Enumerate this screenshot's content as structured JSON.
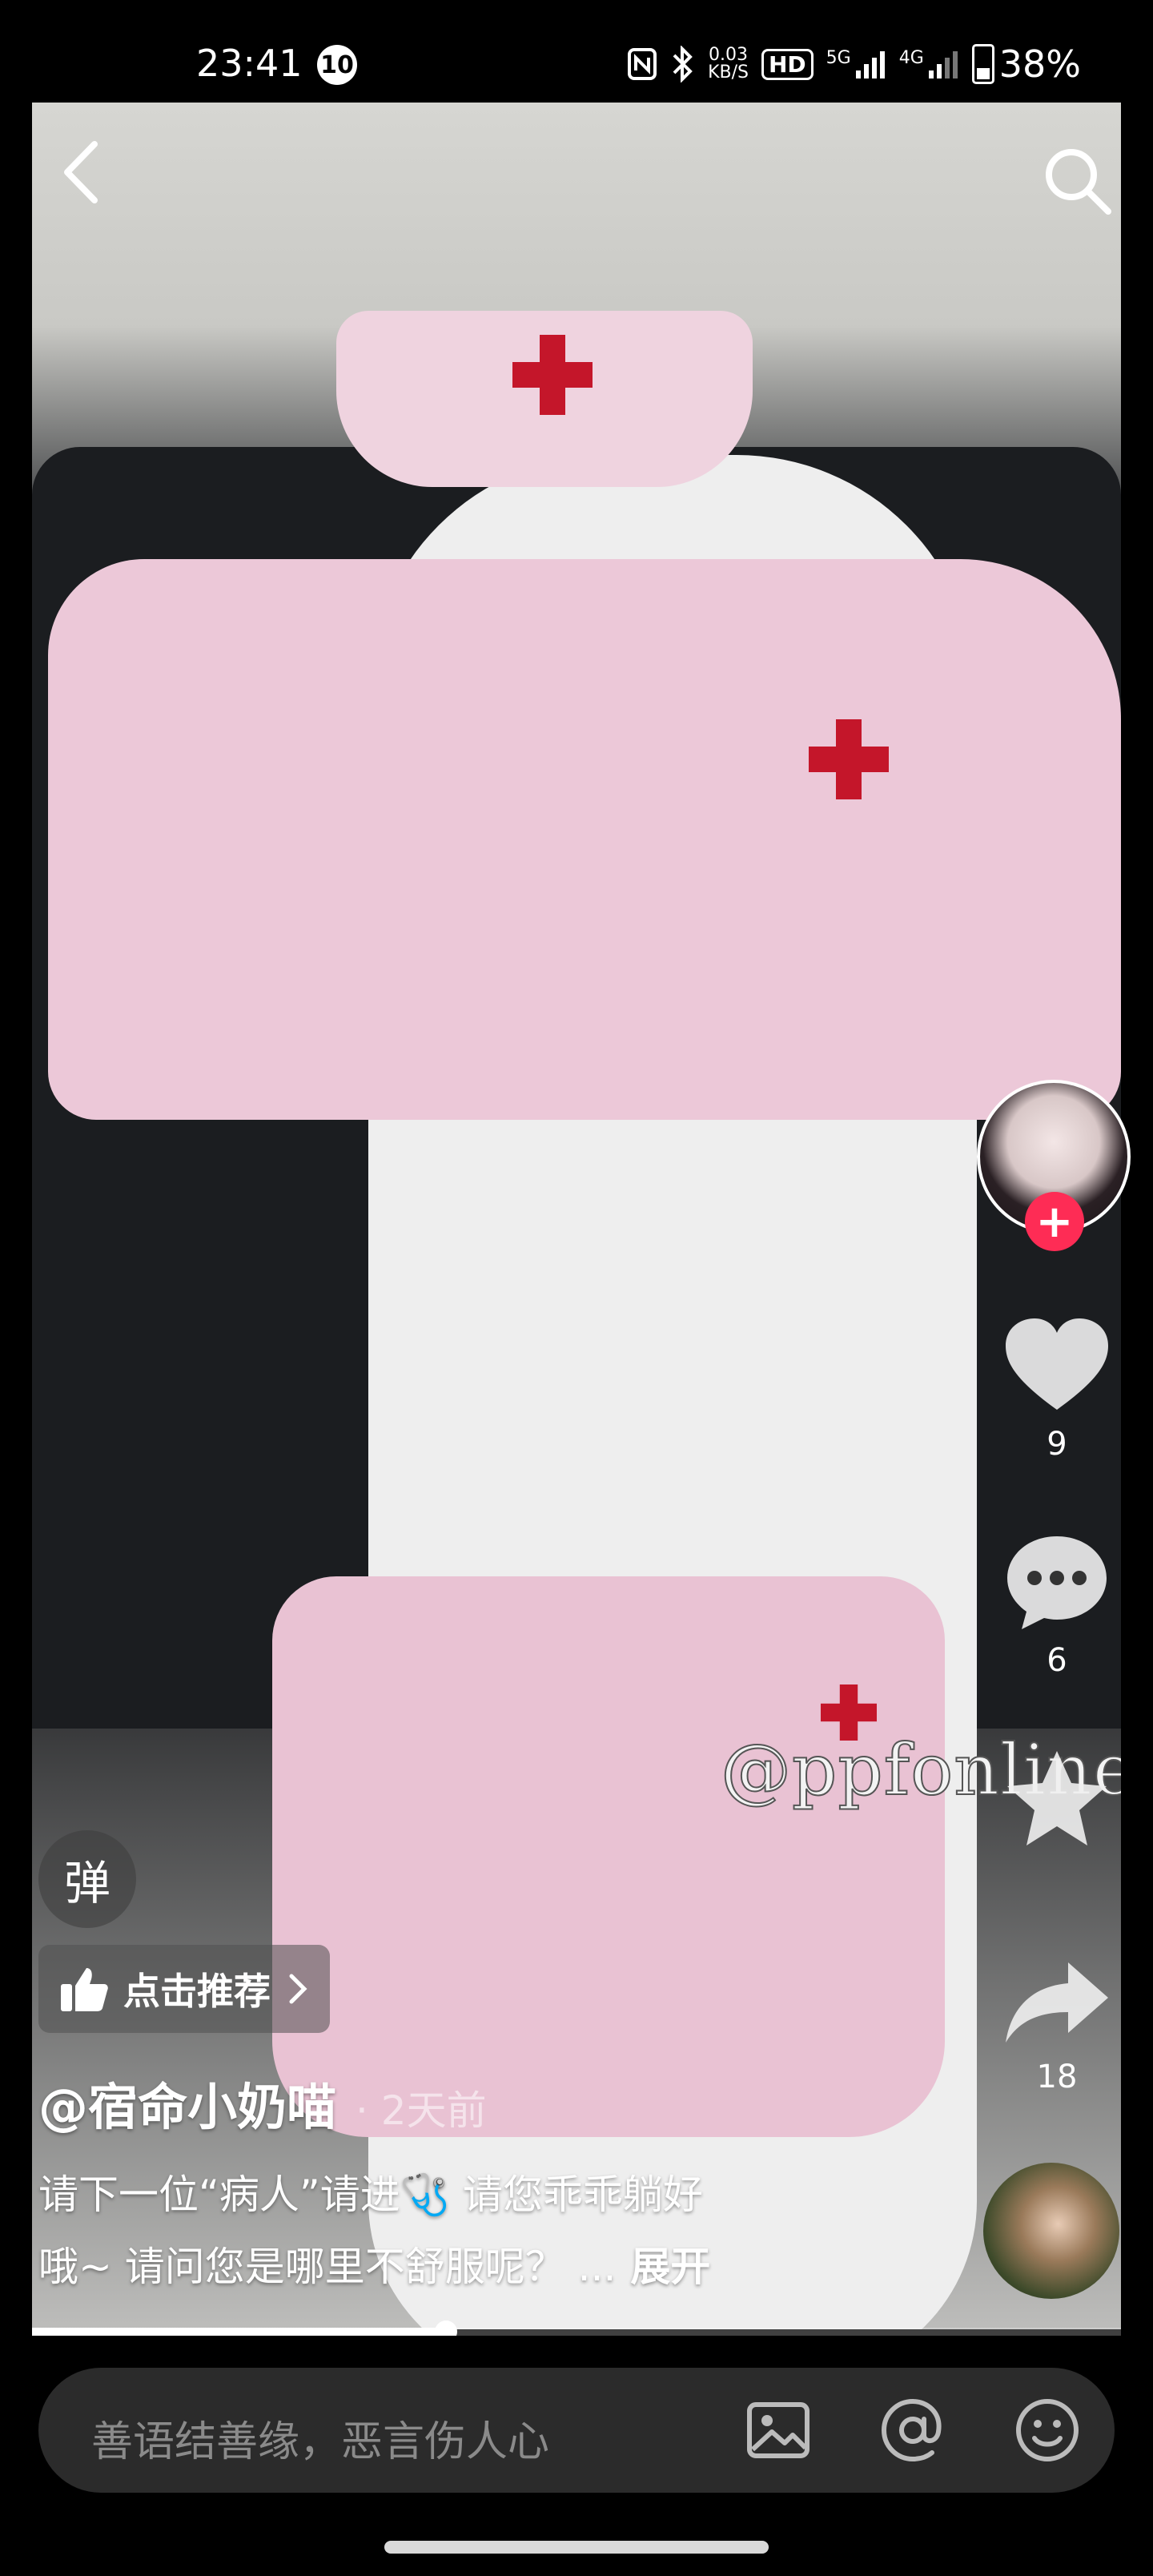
{
  "status_bar": {
    "time": "23:41",
    "notification_count": "10",
    "net_speed_value": "0.03",
    "net_speed_unit": "KB/S",
    "hd_label": "HD",
    "signal_1": "5G",
    "signal_2": "4G",
    "battery": "38%",
    "battery_level": 0.38
  },
  "video": {
    "watermark": "@ppfonline"
  },
  "actions": {
    "like_count": "9",
    "comment_count": "6",
    "share_count": "18"
  },
  "danmu_label": "弹",
  "recommend_label": "点击推荐",
  "author": "@宿命小奶喵",
  "post_time": "· 2天前",
  "caption_line1": "请下一位“病人”请进🩺 请您乖乖躺好",
  "caption_line2": "哦~ 请问您是哪里不舒服呢？ ...",
  "expand_label": "展开",
  "progress": 0.38,
  "comment_placeholder": "善语结善缘，恶言伤人心",
  "colors": {
    "accent": "#fe2c55"
  }
}
